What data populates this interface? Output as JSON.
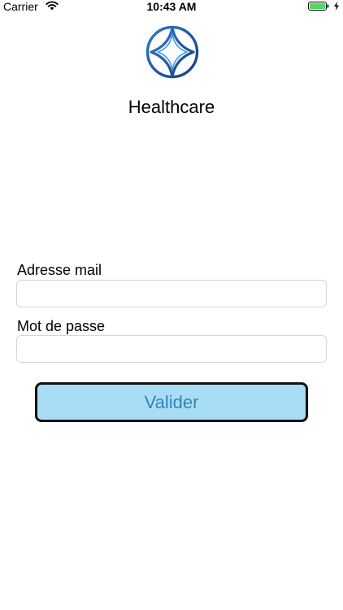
{
  "status_bar": {
    "carrier": "Carrier",
    "time": "10:43 AM",
    "battery_color": "#4cd964",
    "wifi_icon": "wifi-icon",
    "battery_icon": "battery-icon",
    "charging_icon": "bolt-icon"
  },
  "app": {
    "title": "Healthcare",
    "logo_icon": "star-in-circle-logo",
    "logo_color": "#1f4e9a"
  },
  "form": {
    "email_label": "Adresse mail",
    "email_value": "",
    "password_label": "Mot de passe",
    "password_value": "",
    "submit_label": "Valider",
    "submit_bg": "#a9ddf5",
    "submit_text_color": "#2f86b5"
  }
}
